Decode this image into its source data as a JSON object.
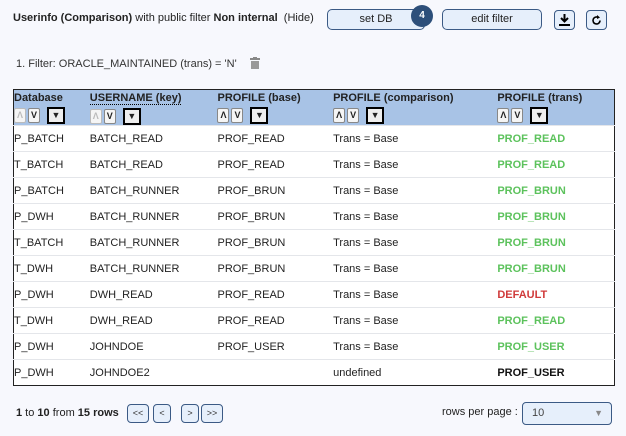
{
  "header": {
    "title_part1": "Userinfo (Comparison)",
    "title_part2": " with public filter ",
    "title_part3": "Non internal",
    "hide": "(Hide)",
    "set_db": "set DB",
    "badge": "4",
    "edit_filter": "edit filter"
  },
  "filter": {
    "text": "1. Filter: ORACLE_MAINTAINED (trans) = 'N'"
  },
  "table": {
    "columns": [
      "Database",
      "USERNAME (key)",
      "PROFILE (base)",
      "PROFILE (comparison)",
      "PROFILE (trans)"
    ],
    "rows": [
      [
        "P_BATCH",
        "BATCH_READ",
        "PROF_READ",
        "Trans = Base",
        "PROF_READ",
        "green"
      ],
      [
        "T_BATCH",
        "BATCH_READ",
        "PROF_READ",
        "Trans = Base",
        "PROF_READ",
        "green"
      ],
      [
        "P_BATCH",
        "BATCH_RUNNER",
        "PROF_BRUN",
        "Trans = Base",
        "PROF_BRUN",
        "green"
      ],
      [
        "P_DWH",
        "BATCH_RUNNER",
        "PROF_BRUN",
        "Trans = Base",
        "PROF_BRUN",
        "green"
      ],
      [
        "T_BATCH",
        "BATCH_RUNNER",
        "PROF_BRUN",
        "Trans = Base",
        "PROF_BRUN",
        "green"
      ],
      [
        "T_DWH",
        "BATCH_RUNNER",
        "PROF_BRUN",
        "Trans = Base",
        "PROF_BRUN",
        "green"
      ],
      [
        "P_DWH",
        "DWH_READ",
        "PROF_READ",
        "Trans = Base",
        "DEFAULT",
        "red"
      ],
      [
        "T_DWH",
        "DWH_READ",
        "PROF_READ",
        "Trans = Base",
        "PROF_READ",
        "green"
      ],
      [
        "P_DWH",
        "JOHNDOE",
        "PROF_USER",
        "Trans = Base",
        "PROF_USER",
        "green"
      ],
      [
        "P_DWH",
        "JOHNDOE2",
        "",
        "undefined",
        "PROF_USER",
        "blk"
      ]
    ]
  },
  "footer": {
    "from": "1",
    "to_label": " to ",
    "to": "10",
    "from_label": " from ",
    "total": "15 rows",
    "first": "<<",
    "prev": "<",
    "next": ">",
    "last": ">>",
    "rows_per_page_label": "rows per page :",
    "rows_per_page": "10"
  },
  "colors": {
    "header_bg": "#a8c3e6",
    "button_bg": "#e6effb",
    "badge": "#2d4f7a",
    "match": "#5cc25c",
    "mismatch": "#d03a3a"
  }
}
